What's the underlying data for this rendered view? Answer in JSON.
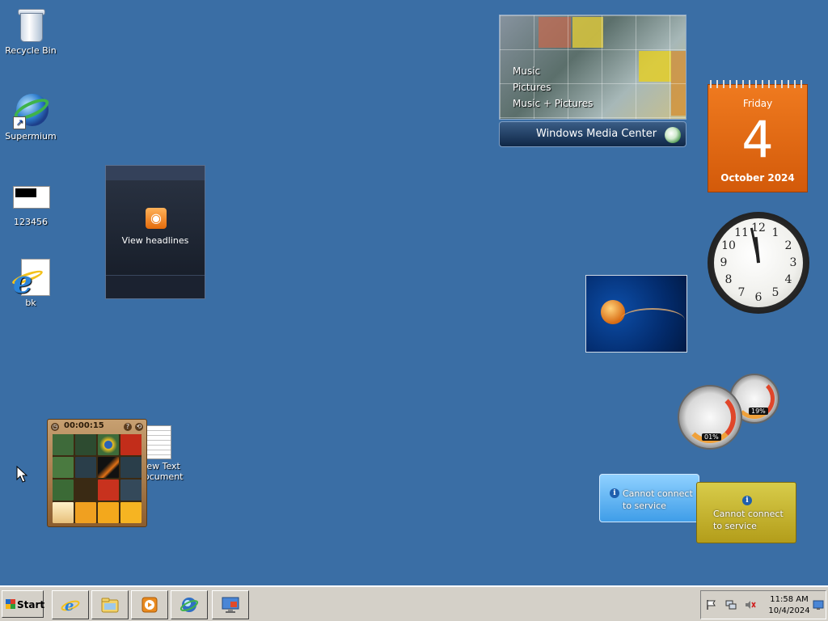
{
  "desktop": {
    "icons": [
      {
        "label": "Recycle Bin"
      },
      {
        "label": "Supermium"
      },
      {
        "label": "123456"
      },
      {
        "label": "bk"
      }
    ],
    "text_doc_label": "New Text Document"
  },
  "gadgets": {
    "feed": {
      "text": "View headlines"
    },
    "media_center": {
      "items": [
        "Music",
        "Pictures",
        "Music + Pictures"
      ],
      "title": "Windows Media Center"
    },
    "calendar": {
      "day_name": "Friday",
      "day": "4",
      "month_year": "October 2024"
    },
    "clock": {
      "numbers": [
        "12",
        "1",
        "2",
        "3",
        "4",
        "5",
        "6",
        "7",
        "8",
        "9",
        "10",
        "11"
      ]
    },
    "cpu_meter": {
      "cpu": "01%",
      "memory": "19%"
    },
    "info_blue": {
      "text_line1": "Cannot connect",
      "text_line2": "to service"
    },
    "info_gold": {
      "text_line1": "Cannot connect",
      "text_line2": "to service"
    },
    "puzzle": {
      "timer": "00:00:15"
    }
  },
  "taskbar": {
    "start_label": "Start",
    "time": "11:58 AM",
    "date": "10/4/2024"
  },
  "colors": {
    "desktop": "#3a6ea5",
    "taskbar": "#d4d0c8",
    "calendar": "#e06810"
  }
}
